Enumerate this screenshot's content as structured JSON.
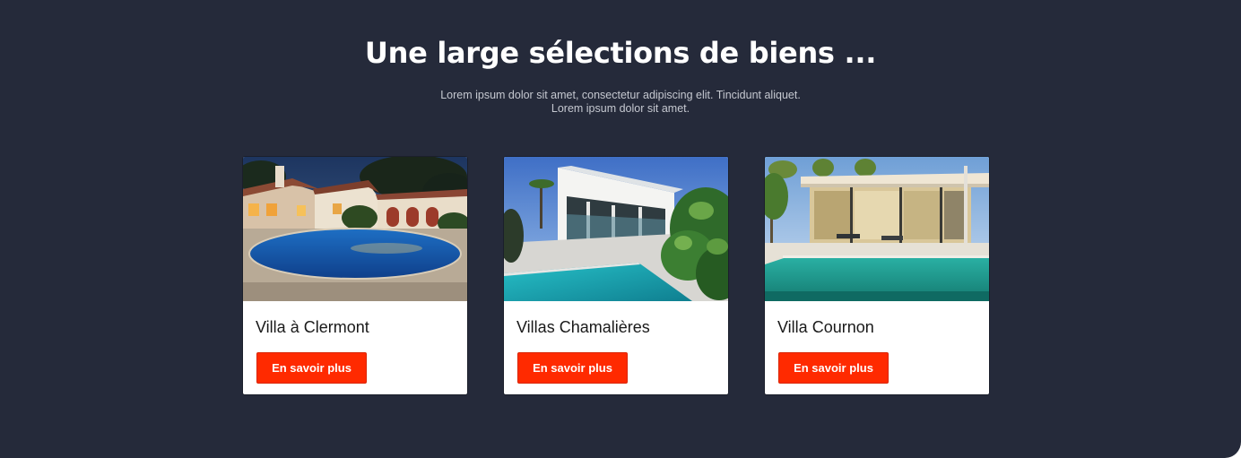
{
  "section": {
    "heading": "Une large sélections de biens ...",
    "subtitle_line1": "Lorem ipsum dolor sit amet, consectetur adipiscing elit. Tincidunt aliquet.",
    "subtitle_line2": "Lorem ipsum dolor sit amet."
  },
  "cards": [
    {
      "title": "Villa à Clermont",
      "button_label": "En savoir plus",
      "image": "villa-night-pool-photo"
    },
    {
      "title": "Villas Chamalières",
      "button_label": "En savoir plus",
      "image": "modern-villa-pool-photo"
    },
    {
      "title": "Villa Cournon",
      "button_label": "En savoir plus",
      "image": "glass-house-pool-photo"
    }
  ],
  "colors": {
    "background": "#252a3a",
    "button": "#ff2a00",
    "card": "#ffffff"
  }
}
